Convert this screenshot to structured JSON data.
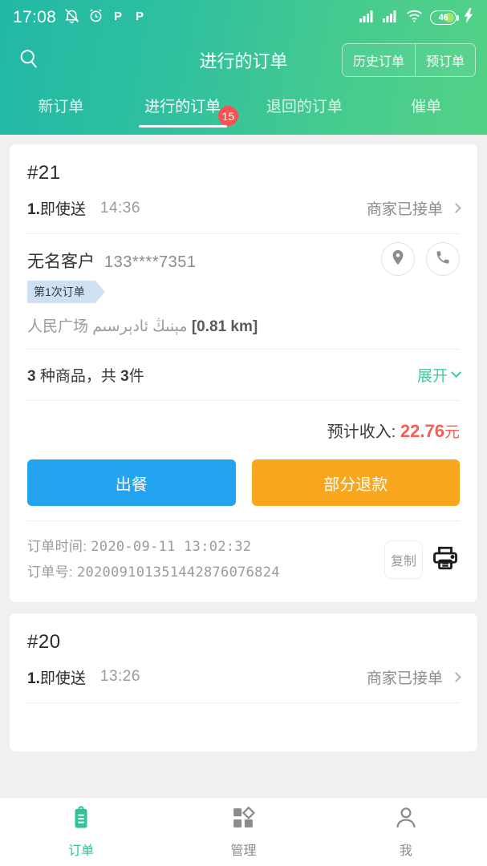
{
  "status_bar": {
    "time": "17:08",
    "battery_level": "46",
    "icons": [
      "bell-muted-icon",
      "alarm-icon",
      "p-icon",
      "p-icon",
      "signal-icon",
      "signal-icon",
      "wifi-icon",
      "battery-icon",
      "charging-bolt-icon"
    ]
  },
  "header": {
    "title": "进行的订单",
    "search_icon": "search-icon",
    "segment": [
      {
        "label": "历史订单"
      },
      {
        "label": "预订单"
      }
    ]
  },
  "tabs": [
    {
      "label": "新订单",
      "badge": "",
      "active": false
    },
    {
      "label": "进行的订单",
      "badge": "15",
      "active": true
    },
    {
      "label": "退回的订单",
      "badge": "",
      "active": false
    },
    {
      "label": "催单",
      "badge": "",
      "active": false
    }
  ],
  "orders": [
    {
      "number": "#21",
      "type_index": "1.",
      "type_label": "即使送",
      "time": "14:36",
      "status": "商家已接单",
      "customer_name": "无名客户",
      "customer_phone": "133****7351",
      "customer_tag": "第1次订单",
      "address": "人民广场 مېنىڭ ئادېرسىم ",
      "distance": "[0.81 km]",
      "goods_kinds": "3",
      "goods_kinds_unit": " 种商品，共 ",
      "goods_count": "3",
      "goods_count_unit": "件",
      "expand_label": "展开",
      "income_label": "预计收入: ",
      "income_amount": "22.76",
      "income_unit": "元",
      "buttons": [
        {
          "label": "出餐",
          "style": "primary"
        },
        {
          "label": "部分退款",
          "style": "warn"
        }
      ],
      "order_time_label": "订单时间: ",
      "order_time": "2020-09-11  13:02:32",
      "order_id_label": "订单号: ",
      "order_id": "202009101351442876076824",
      "copy_label": "复制",
      "print_icon": "printer-icon"
    },
    {
      "number": "#20",
      "type_index": "1.",
      "type_label": "即使送",
      "time": "13:26",
      "status": "商家已接单"
    }
  ],
  "bottom_nav": [
    {
      "label": "订单",
      "icon": "clipboard-icon",
      "active": true
    },
    {
      "label": "管理",
      "icon": "grid-icon",
      "active": false
    },
    {
      "label": "我",
      "icon": "person-icon",
      "active": false
    }
  ],
  "colors": {
    "header_start": "#22b8a6",
    "header_end": "#53d286",
    "accent_green": "#3fcb9a",
    "badge_red": "#fb5151",
    "price_red": "#fb5c52",
    "button_blue": "#23a3f0",
    "button_orange": "#f7a61e",
    "tag_blue": "#cfe0f2"
  }
}
